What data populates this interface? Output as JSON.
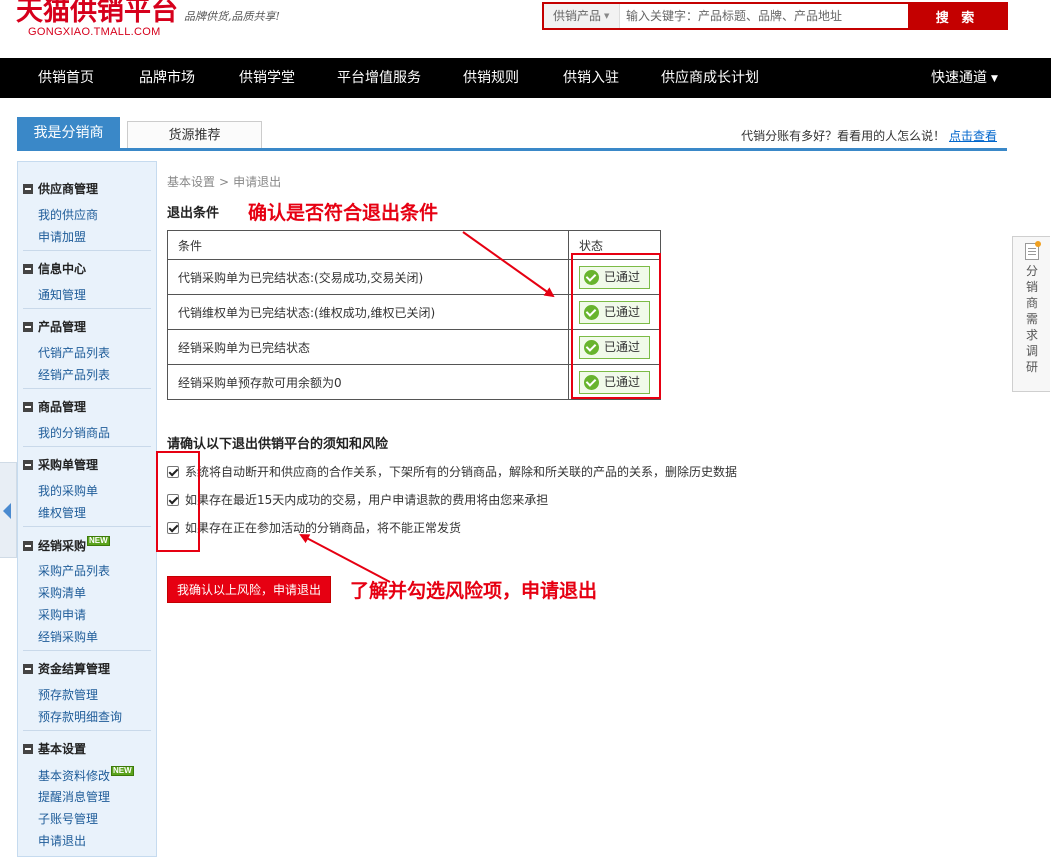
{
  "header": {
    "logo_main": "天猫供销平台",
    "logo_slogan": "品牌供货,品质共享!",
    "logo_sub": "GONGXIAO.TMALL.COM",
    "search_category": "供销产品",
    "search_placeholder": "输入关键字：产品标题、品牌、产品地址",
    "search_button": "搜 索"
  },
  "nav": {
    "items": [
      "供销首页",
      "品牌市场",
      "供销学堂",
      "平台增值服务",
      "供销规则",
      "供销入驻",
      "供应商成长计划"
    ],
    "quick": "快速通道"
  },
  "tabs": {
    "active": "我是分销商",
    "inactive": "货源推荐",
    "notice_text": "代销分账有多好？看看用的人怎么说！",
    "notice_link": "点击查看"
  },
  "sidebar": {
    "groups": [
      {
        "title": "供应商管理",
        "items": [
          "我的供应商",
          "申请加盟"
        ]
      },
      {
        "title": "信息中心",
        "items": [
          "通知管理"
        ]
      },
      {
        "title": "产品管理",
        "items": [
          "代销产品列表",
          "经销产品列表"
        ]
      },
      {
        "title": "商品管理",
        "items": [
          "我的分销商品"
        ]
      },
      {
        "title": "采购单管理",
        "items": [
          "我的采购单",
          "维权管理"
        ]
      },
      {
        "title": "经销采购",
        "items": [
          "采购产品列表",
          "采购清单",
          "采购申请",
          "经销采购单"
        ]
      },
      {
        "title": "资金结算管理",
        "items": [
          "预存款管理",
          "预存款明细查询"
        ]
      },
      {
        "title": "基本设置",
        "items": [
          "基本资料修改",
          "提醒消息管理",
          "子账号管理",
          "申请退出"
        ]
      }
    ],
    "new_badge": "NEW"
  },
  "main": {
    "breadcrumb": [
      "基本设置",
      "申请退出"
    ],
    "breadcrumb_sep": ">",
    "section_title": "退出条件",
    "annotation_top": "确认是否符合退出条件",
    "table": {
      "headers": [
        "条件",
        "状态"
      ],
      "rows": [
        {
          "condition": "代销采购单为已完结状态:(交易成功,交易关闭)",
          "status": "已通过"
        },
        {
          "condition": "代销维权单为已完结状态:(维权成功,维权已关闭)",
          "status": "已通过"
        },
        {
          "condition": "经销采购单为已完结状态",
          "status": "已通过"
        },
        {
          "condition": "经销采购单预存款可用余额为0",
          "status": "已通过"
        }
      ]
    },
    "risk_title": "请确认以下退出供销平台的须知和风险",
    "risks": [
      "系统将自动断开和供应商的合作关系，下架所有的分销商品，解除和所关联的产品的关系，删除历史数据",
      "如果存在最近15天内成功的交易，用户申请退款的费用将由您来承担",
      "如果存在正在参加活动的分销商品，将不能正常发货"
    ],
    "confirm_button": "我确认以上风险，申请退出",
    "annotation_bottom": "了解并勾选风险项，申请退出"
  },
  "survey": {
    "text": "分销商需求调研"
  },
  "colors": {
    "brand_red": "#d6001c",
    "nav_bg": "#000000",
    "tab_blue": "#3a88c8",
    "annotation_red": "#e60012",
    "passed_green": "#68b42e"
  }
}
